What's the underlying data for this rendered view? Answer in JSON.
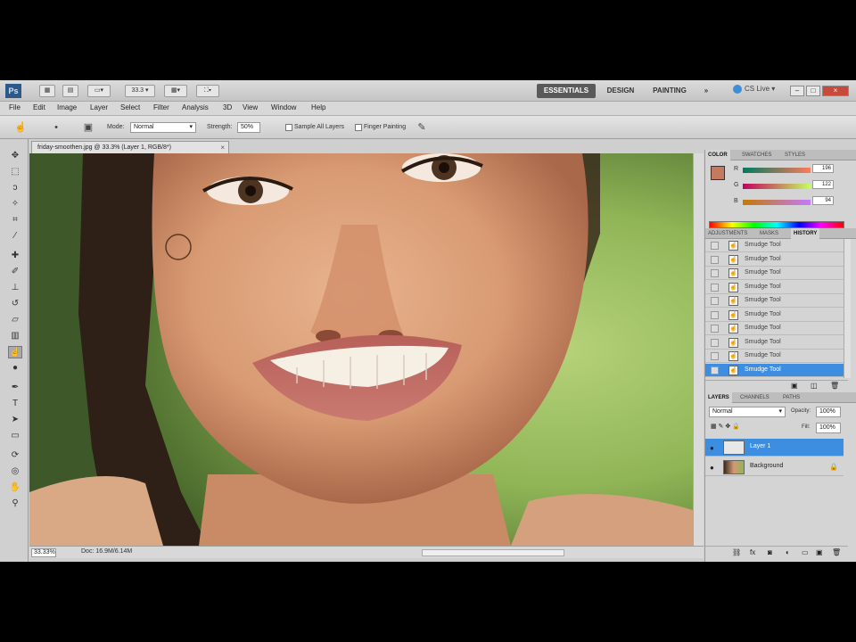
{
  "app": {
    "logo": "Ps",
    "zoom_menu": "33.3",
    "workspaces": [
      "ESSENTIALS",
      "DESIGN",
      "PAINTING"
    ],
    "workspace_more": "»",
    "cs_live": "CS Live",
    "window_buttons": [
      "–",
      "□",
      "×"
    ]
  },
  "menu": [
    "File",
    "Edit",
    "Image",
    "Layer",
    "Select",
    "Filter",
    "Analysis",
    "3D",
    "View",
    "Window",
    "Help"
  ],
  "options": {
    "mode_label": "Mode:",
    "mode_value": "Normal",
    "strength_label": "Strength:",
    "strength_value": "50%",
    "sample_all_layers": "Sample All Layers",
    "finger_painting": "Finger Painting"
  },
  "document": {
    "tab_title": "friday-smoothen.jpg @ 33.3% (Layer 1, RGB/8*)",
    "zoom": "33.33%",
    "doc_info": "Doc: 16.9M/6.14M"
  },
  "color_panel": {
    "tabs": [
      "COLOR",
      "SWATCHES",
      "STYLES"
    ],
    "r_label": "R",
    "r_value": "196",
    "g_label": "G",
    "g_value": "122",
    "b_label": "B",
    "b_value": "94",
    "fg_color": "#c47a5e"
  },
  "history_panel": {
    "tabs": [
      "ADJUSTMENTS",
      "MASKS",
      "HISTORY"
    ],
    "items": [
      {
        "label": "Smudge Tool"
      },
      {
        "label": "Smudge Tool"
      },
      {
        "label": "Smudge Tool"
      },
      {
        "label": "Smudge Tool"
      },
      {
        "label": "Smudge Tool"
      },
      {
        "label": "Smudge Tool"
      },
      {
        "label": "Smudge Tool"
      },
      {
        "label": "Smudge Tool"
      },
      {
        "label": "Smudge Tool"
      },
      {
        "label": "Smudge Tool"
      }
    ]
  },
  "layers_panel": {
    "tabs": [
      "LAYERS",
      "CHANNELS",
      "PATHS"
    ],
    "blend_mode": "Normal",
    "opacity_label": "Opacity:",
    "opacity_value": "100%",
    "fill_label": "Fill:",
    "fill_value": "100%",
    "layers": [
      {
        "name": "Layer 1"
      },
      {
        "name": "Background"
      }
    ]
  },
  "accent_color": "#3d8ee0"
}
